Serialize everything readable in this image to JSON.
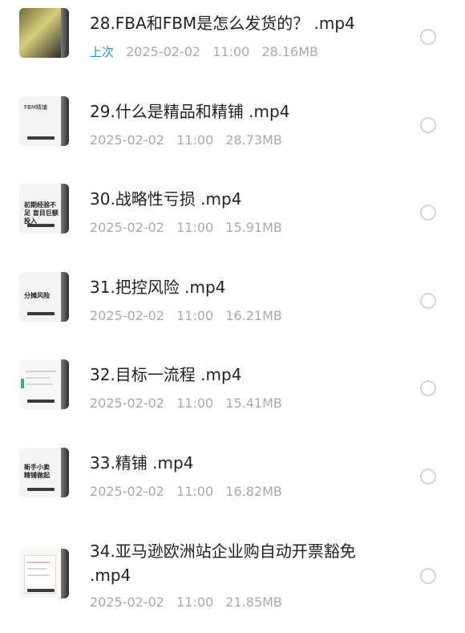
{
  "items": [
    {
      "title": "28.FBA和FBM是怎么发货的？ .mp4",
      "badge": "上次",
      "date": "2025-02-02",
      "time": "11:00",
      "size": "28.16MB"
    },
    {
      "title": "29.什么是精品和精铺 .mp4",
      "date": "2025-02-02",
      "time": "11:00",
      "size": "28.73MB",
      "thumb_caption": "FBM精铺"
    },
    {
      "title": "30.战略性亏损 .mp4",
      "date": "2025-02-02",
      "time": "11:00",
      "size": "15.91MB",
      "thumb_caption": "初期经验不足 盲目巨额投入"
    },
    {
      "title": "31.把控风险 .mp4",
      "date": "2025-02-02",
      "time": "11:00",
      "size": "16.21MB",
      "thumb_caption": "分摊风险"
    },
    {
      "title": "32.目标一流程 .mp4",
      "date": "2025-02-02",
      "time": "11:00",
      "size": "15.41MB"
    },
    {
      "title": "33.精铺 .mp4",
      "date": "2025-02-02",
      "time": "11:00",
      "size": "16.82MB",
      "thumb_caption": "新手小卖 精铺做起"
    },
    {
      "title": "34.亚马逊欧洲站企业购自动开票豁免 .mp4",
      "date": "2025-02-02",
      "time": "11:00",
      "size": "21.85MB"
    }
  ]
}
